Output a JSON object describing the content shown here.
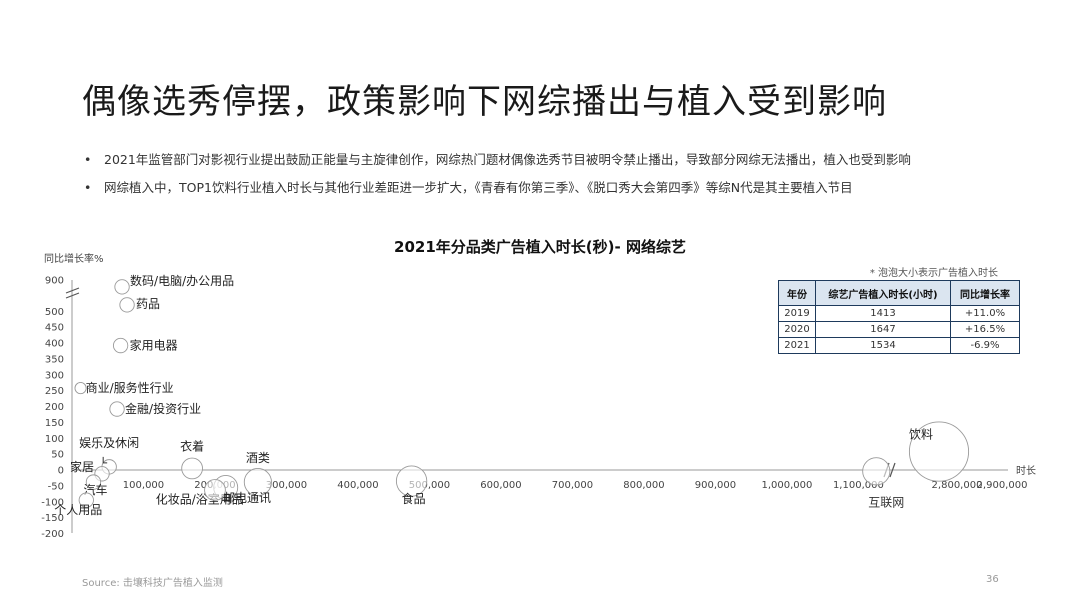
{
  "title": "偶像选秀停摆，政策影响下网综播出与植入受到影响",
  "bullets": [
    "2021年监管部门对影视行业提出鼓励正能量与主旋律创作，网综热门题材偶像选秀节目被明令禁止播出，导致部分网综无法播出，植入也受到影响",
    "网综植入中，TOP1饮料行业植入时长与其他行业差距进一步扩大，《青春有你第三季》、《脱口秀大会第四季》等综N代是其主要植入节目"
  ],
  "bullet_marker": "•",
  "note": "* 泡泡大小表示广告植入时长",
  "table": {
    "headers": [
      "年份",
      "综艺广告植入时长(小时)",
      "同比增长率"
    ],
    "rows": [
      {
        "year": "2019",
        "hours": "1413",
        "growth": "+11.0%"
      },
      {
        "year": "2020",
        "hours": "1647",
        "growth": "+16.5%"
      },
      {
        "year": "2021",
        "hours": "1534",
        "growth": "-6.9%"
      }
    ],
    "colors": {
      "positive": "#d0243a",
      "negative": "#2e9a3a",
      "header_bg": "#dbe5f0",
      "border": "#1e3a5c"
    }
  },
  "chart_data": {
    "type": "scatter",
    "title": "2021年分品类广告植入时长(秒)- 网络综艺",
    "xlabel": "时长",
    "ylabel": "同比增长率%",
    "x_ticks": [
      "100,000",
      "200,000",
      "300,000",
      "400,000",
      "500,000",
      "600,000",
      "700,000",
      "800,000",
      "900,000",
      "1,000,000",
      "1,100,000",
      "2,800,000",
      "2,900,000"
    ],
    "y_ticks": [
      "900",
      "500",
      "450",
      "400",
      "350",
      "300",
      "250",
      "200",
      "150",
      "100",
      "50",
      "0",
      "-50",
      "-100",
      "-150",
      "-200"
    ],
    "xlim": [
      0,
      2900000
    ],
    "ylim": [
      -200,
      900
    ],
    "axis_break_x": [
      1140000,
      2740000
    ],
    "axis_break_y": [
      530,
      880
    ],
    "series": [
      {
        "label": "数码/电脑/办公用品",
        "x": 70000,
        "y": 555,
        "size": 1
      },
      {
        "label": "药品",
        "x": 77000,
        "y": 520,
        "size": 1
      },
      {
        "label": "家用电器",
        "x": 68000,
        "y": 392,
        "size": 1
      },
      {
        "label": "商业/服务性行业",
        "x": 12000,
        "y": 258,
        "size": 0.5
      },
      {
        "label": "金融/投资行业",
        "x": 63000,
        "y": 192,
        "size": 1
      },
      {
        "label": "娱乐及休闲",
        "x": 52000,
        "y": 10,
        "size": 1
      },
      {
        "label": "家居",
        "x": 42000,
        "y": -12,
        "size": 1
      },
      {
        "label": "衣着",
        "x": 168000,
        "y": 5,
        "size": 2
      },
      {
        "label": "酒类",
        "x": 260000,
        "y": -38,
        "size": 3
      },
      {
        "label": "汽车",
        "x": 30000,
        "y": -38,
        "size": 1
      },
      {
        "label": "化妆品/浴室用品",
        "x": 215000,
        "y": -55,
        "size": 2.5
      },
      {
        "label": "邮电通讯",
        "x": 200000,
        "y": -63,
        "size": 2
      },
      {
        "label": "个人用品",
        "x": 20000,
        "y": -95,
        "size": 1
      },
      {
        "label": "食品",
        "x": 475000,
        "y": -35,
        "size": 3.5
      },
      {
        "label": "饮料",
        "x": 2760000,
        "y": 58,
        "size": 8
      },
      {
        "label": "互联网",
        "x": 1125000,
        "y": -4,
        "size": 3
      }
    ]
  },
  "footer": "Source: 击壤科技广告植入监测",
  "page_number": "36"
}
